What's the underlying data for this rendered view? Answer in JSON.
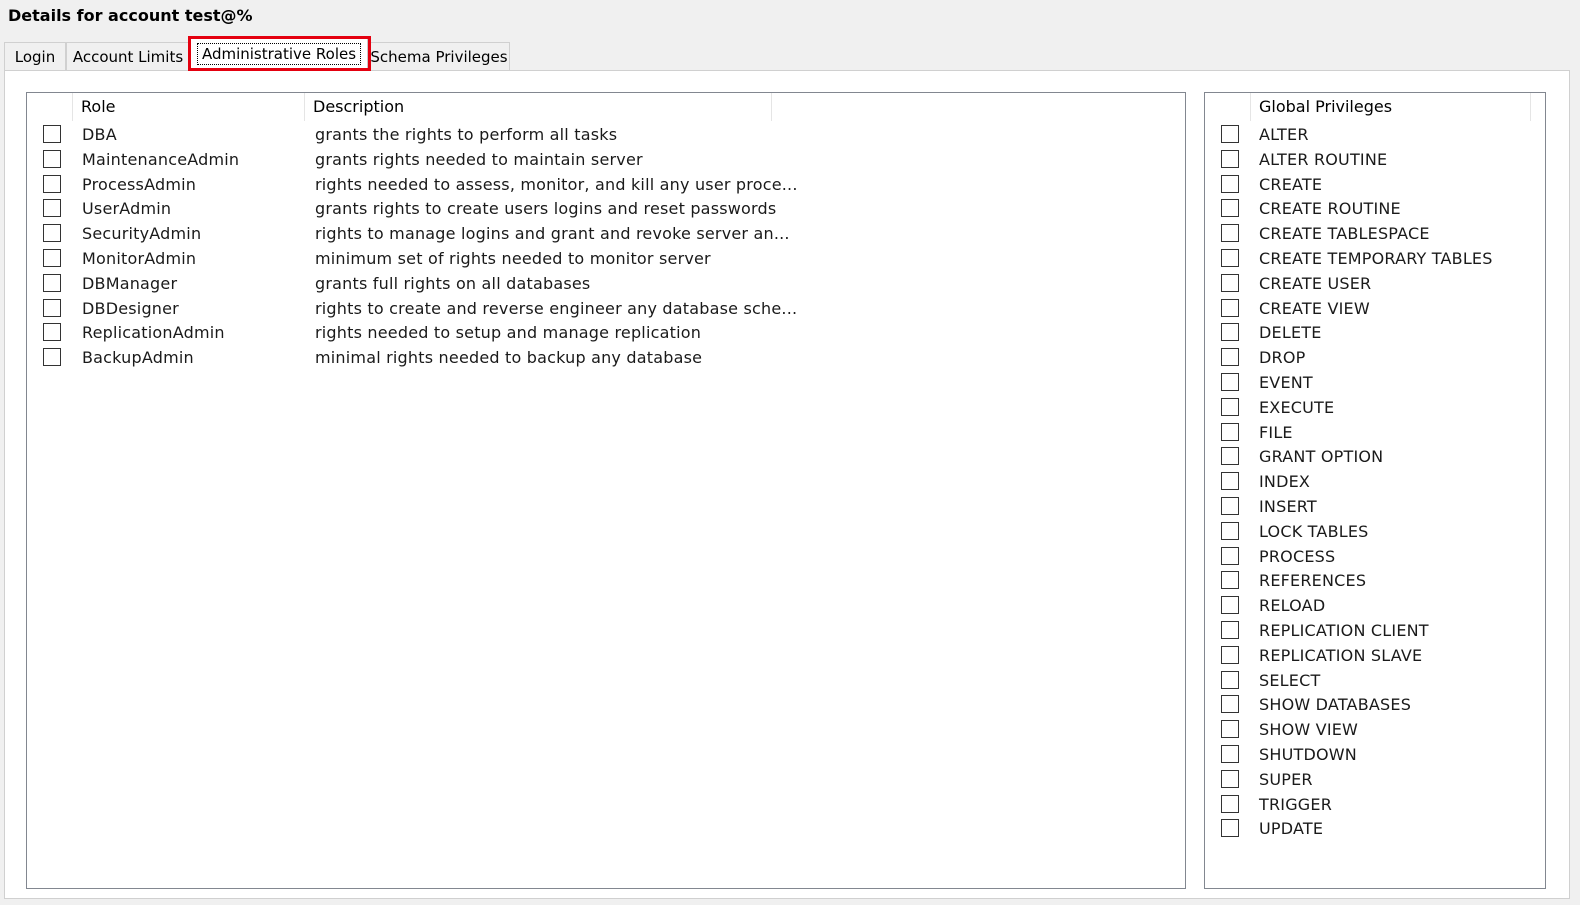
{
  "window": {
    "title": "Details for account test@%"
  },
  "tabs": [
    {
      "label": "Login"
    },
    {
      "label": "Account Limits"
    },
    {
      "label": "Administrative Roles"
    },
    {
      "label": "Schema Privileges"
    }
  ],
  "roles": {
    "headers": {
      "role": "Role",
      "description": "Description"
    },
    "rows": [
      {
        "role": "DBA",
        "description": "grants the rights to perform all tasks",
        "checked": false
      },
      {
        "role": "MaintenanceAdmin",
        "description": "grants rights needed to maintain server",
        "checked": false
      },
      {
        "role": "ProcessAdmin",
        "description": "rights needed to assess, monitor, and kill any user proce...",
        "checked": false
      },
      {
        "role": "UserAdmin",
        "description": "grants rights to create users logins and reset passwords",
        "checked": false
      },
      {
        "role": "SecurityAdmin",
        "description": "rights to manage logins and grant and revoke server an...",
        "checked": false
      },
      {
        "role": "MonitorAdmin",
        "description": "minimum set of rights needed to monitor server",
        "checked": false
      },
      {
        "role": "DBManager",
        "description": "grants full rights on all databases",
        "checked": false
      },
      {
        "role": "DBDesigner",
        "description": "rights to create and reverse engineer any database sche...",
        "checked": false
      },
      {
        "role": "ReplicationAdmin",
        "description": "rights needed to setup and manage replication",
        "checked": false
      },
      {
        "role": "BackupAdmin",
        "description": "minimal rights needed to backup any database",
        "checked": false
      }
    ]
  },
  "global_privileges": {
    "header": "Global Privileges",
    "items": [
      "ALTER",
      "ALTER ROUTINE",
      "CREATE",
      "CREATE ROUTINE",
      "CREATE TABLESPACE",
      "CREATE TEMPORARY TABLES",
      "CREATE USER",
      "CREATE VIEW",
      "DELETE",
      "DROP",
      "EVENT",
      "EXECUTE",
      "FILE",
      "GRANT OPTION",
      "INDEX",
      "INSERT",
      "LOCK TABLES",
      "PROCESS",
      "REFERENCES",
      "RELOAD",
      "REPLICATION CLIENT",
      "REPLICATION SLAVE",
      "SELECT",
      "SHOW DATABASES",
      "SHOW VIEW",
      "SHUTDOWN",
      "SUPER",
      "TRIGGER",
      "UPDATE"
    ]
  },
  "colors": {
    "highlight": "#e4000f"
  }
}
